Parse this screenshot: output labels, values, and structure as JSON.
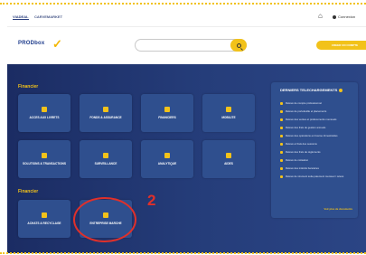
{
  "topbar": {
    "tabs": [
      "VIADEAL",
      "CARVEMARKET"
    ],
    "user_label": "Connexion",
    "home_icon": "home-icon",
    "menu_icon": "menu-icon"
  },
  "header": {
    "logo_text": "PRODbox",
    "logo_sub": "",
    "search_placeholder": "",
    "cta_label": "CREER UN COMPTE"
  },
  "sections": [
    {
      "title": "Financier",
      "tiles": [
        {
          "label": "ACCES AUX LIVRETS"
        },
        {
          "label": "FONDS & ASSURANCE"
        },
        {
          "label": "FINANCIERS"
        },
        {
          "label": "MOBILITE"
        },
        {
          "label": "SOLUTIONS & TRANSACTIONS"
        },
        {
          "label": "SURVEILLANCE"
        },
        {
          "label": "ANALYTIQUE"
        },
        {
          "label": "AIDES"
        }
      ]
    },
    {
      "title": "Financier",
      "tiles": [
        {
          "label": "ACHATS & RECYCLAGE"
        },
        {
          "label": "ENTREPRISE MARCHE"
        }
      ]
    }
  ],
  "rightpanel": {
    "title": "DERNIERS TELECHARGEMENTS",
    "items": [
      "Relevé de compte professionnel",
      "Relevé de portefeuille et placements",
      "Relevé des ventes et prélèvements mensuels",
      "Relevé des frais de gestion annuels",
      "Relevé des opérations en bourse trimestrielles",
      "Relevé et frais des sessions",
      "Relevé des frais de règlements",
      "Relevé de cotisation",
      "Relevé des intérêts bancaires",
      "Relevé de virement suite paiement mensuel / relevé"
    ],
    "more_label": "Voir plus de documents"
  },
  "annotation": {
    "marker": "2"
  },
  "colors": {
    "accent": "#f2c21a",
    "main_bg": "#253d7a",
    "tile_bg": "#2f4f8e",
    "annotation_red": "#e0302a"
  }
}
